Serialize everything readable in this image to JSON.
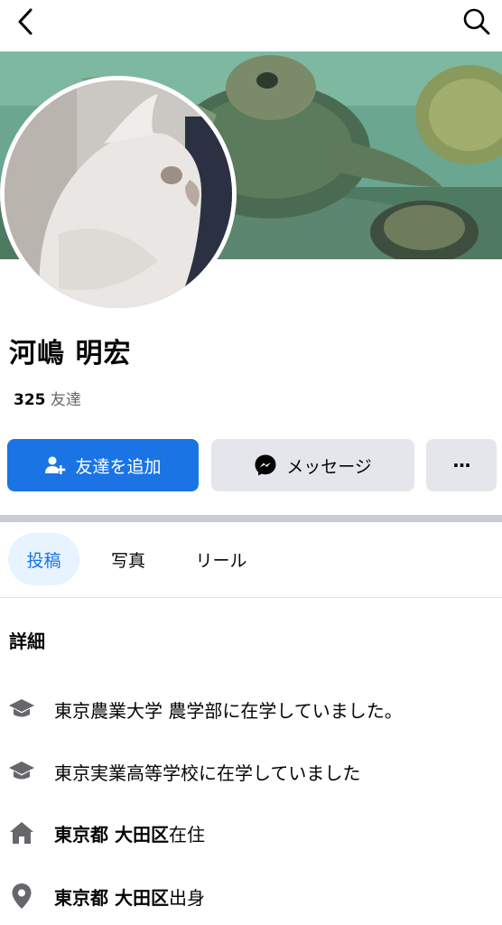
{
  "header": {
    "back_icon": "chevron-left-icon",
    "search_icon": "search-icon"
  },
  "profile": {
    "name": "河嶋 明宏",
    "friends_count": "325",
    "friends_label": "友達"
  },
  "actions": {
    "add_friend_label": "友達を追加",
    "message_label": "メッセージ",
    "more_label": "···"
  },
  "tabs": [
    {
      "label": "投稿",
      "active": true
    },
    {
      "label": "写真",
      "active": false
    },
    {
      "label": "リール",
      "active": false
    }
  ],
  "details": {
    "title": "詳細",
    "items": [
      {
        "icon": "graduation-cap-icon",
        "text": "東京農業大学 農学部に在学していました。"
      },
      {
        "icon": "graduation-cap-icon",
        "text": "東京実業高等学校に在学していました"
      },
      {
        "icon": "home-icon",
        "bold": "東京都 大田区",
        "text": "在住"
      },
      {
        "icon": "location-pin-icon",
        "bold": "東京都 大田区",
        "text": "出身"
      }
    ]
  },
  "colors": {
    "accent": "#1b74e4",
    "button_gray": "#e4e6eb",
    "icon_gray": "#65676b"
  }
}
